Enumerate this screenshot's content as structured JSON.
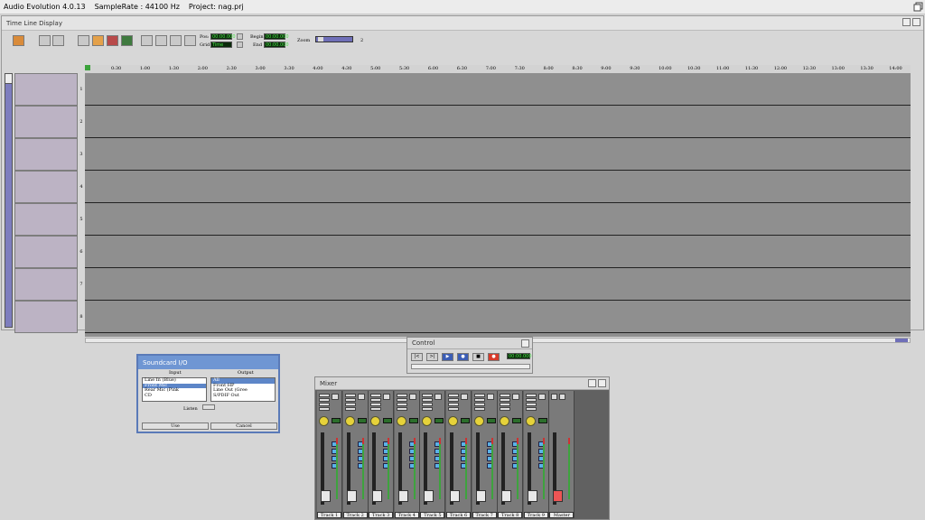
{
  "app": {
    "title": "Audio Evolution 4.0.13",
    "samplerate": "SampleRate : 44100 Hz",
    "project": "Project: nag.prj"
  },
  "timeline": {
    "title": "Time Line Display",
    "pos_label": "Pos:",
    "pos_value": "00:00.000",
    "grid_label": "Grid",
    "grid_value": "Time",
    "begin_label": "Begin",
    "begin_value": "00:00.000",
    "end_label": "End",
    "end_value": "00:00.000",
    "zoom_label": "Zoom",
    "zoom_value": "2",
    "ruler": [
      "0:30",
      "1:00",
      "1:30",
      "2:00",
      "2:30",
      "3:00",
      "3:30",
      "4:00",
      "4:30",
      "5:00",
      "5:30",
      "6:00",
      "6:30",
      "7:00",
      "7:30",
      "8:00",
      "8:30",
      "9:00",
      "9:30",
      "10:00",
      "10:30",
      "11:00",
      "11:30",
      "12:00",
      "12:30",
      "13:00",
      "13:30",
      "14:00"
    ],
    "tracks": [
      "1",
      "2",
      "3",
      "4",
      "5",
      "6",
      "7",
      "8"
    ]
  },
  "soundcard": {
    "title": "Soundcard I/O",
    "input_header": "Input",
    "output_header": "Output",
    "inputs": [
      "Line In (Blue)",
      "Front Mic",
      "Rear Mic (Pink",
      "CD"
    ],
    "outputs": [
      "All",
      "Front HP",
      "Line Out (Gree",
      "S/PDIF Out"
    ],
    "listen_label": "Listen",
    "use_label": "Use",
    "cancel_label": "Cancel"
  },
  "control": {
    "title": "Control",
    "time": "00:00.000"
  },
  "mixer": {
    "title": "Mixer",
    "strips": [
      "Track 1",
      "Track 2",
      "Track 3",
      "Track 4",
      "Track 5",
      "Track 6",
      "Track 7",
      "Track 8",
      "Track 9"
    ],
    "master": "Master"
  },
  "icons": [
    "restore-icon",
    "folder-icon",
    "zoom-in-icon",
    "zoom-out-icon",
    "select-tool-icon",
    "pencil-tool-icon",
    "envelope-tool-icon",
    "record-icon",
    "rewind-icon",
    "fast-forward-icon",
    "play-icon",
    "stop-icon"
  ],
  "colors": {
    "accent": "#6f96d3",
    "track_head": "#bcb3c4",
    "lane": "#8f8f8f",
    "lcd": "#4ae24a"
  }
}
